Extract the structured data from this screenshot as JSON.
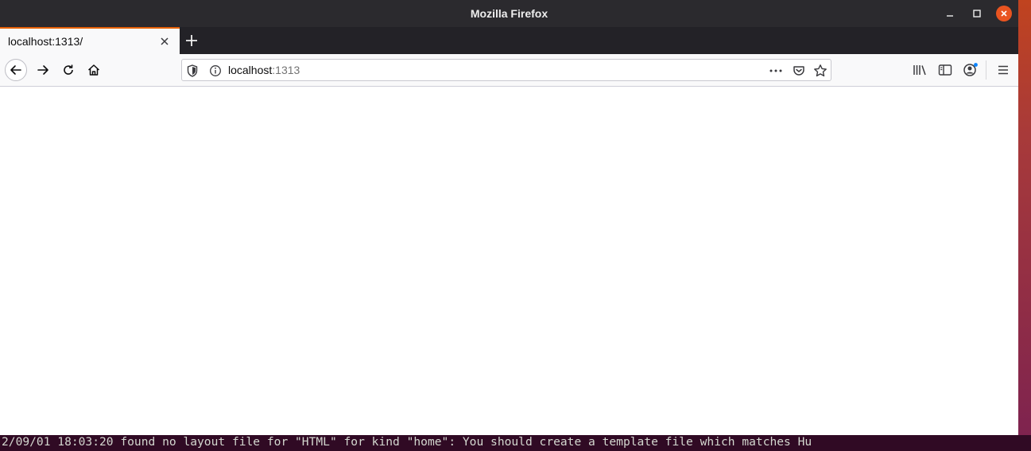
{
  "window": {
    "title": "Mozilla Firefox"
  },
  "tabs": [
    {
      "label": "localhost:1313/"
    }
  ],
  "urlbar": {
    "host": "localhost",
    "port": ":1313"
  },
  "terminal": {
    "line": "2/09/01 18:03:20 found no layout file for \"HTML\" for kind \"home\": You should create a template file which matches Hu"
  },
  "colors": {
    "accent": "#e66000",
    "close_button": "#e95420",
    "titlebar": "#2b2a2e"
  },
  "icons": [
    "minimize-icon",
    "maximize-icon",
    "close-icon",
    "tab-close-icon",
    "new-tab-icon",
    "back-icon",
    "forward-icon",
    "reload-icon",
    "home-icon",
    "tracking-shield-icon",
    "site-info-icon",
    "page-actions-icon",
    "pocket-icon",
    "bookmark-star-icon",
    "library-icon",
    "sidebar-icon",
    "account-icon",
    "hamburger-menu-icon"
  ]
}
